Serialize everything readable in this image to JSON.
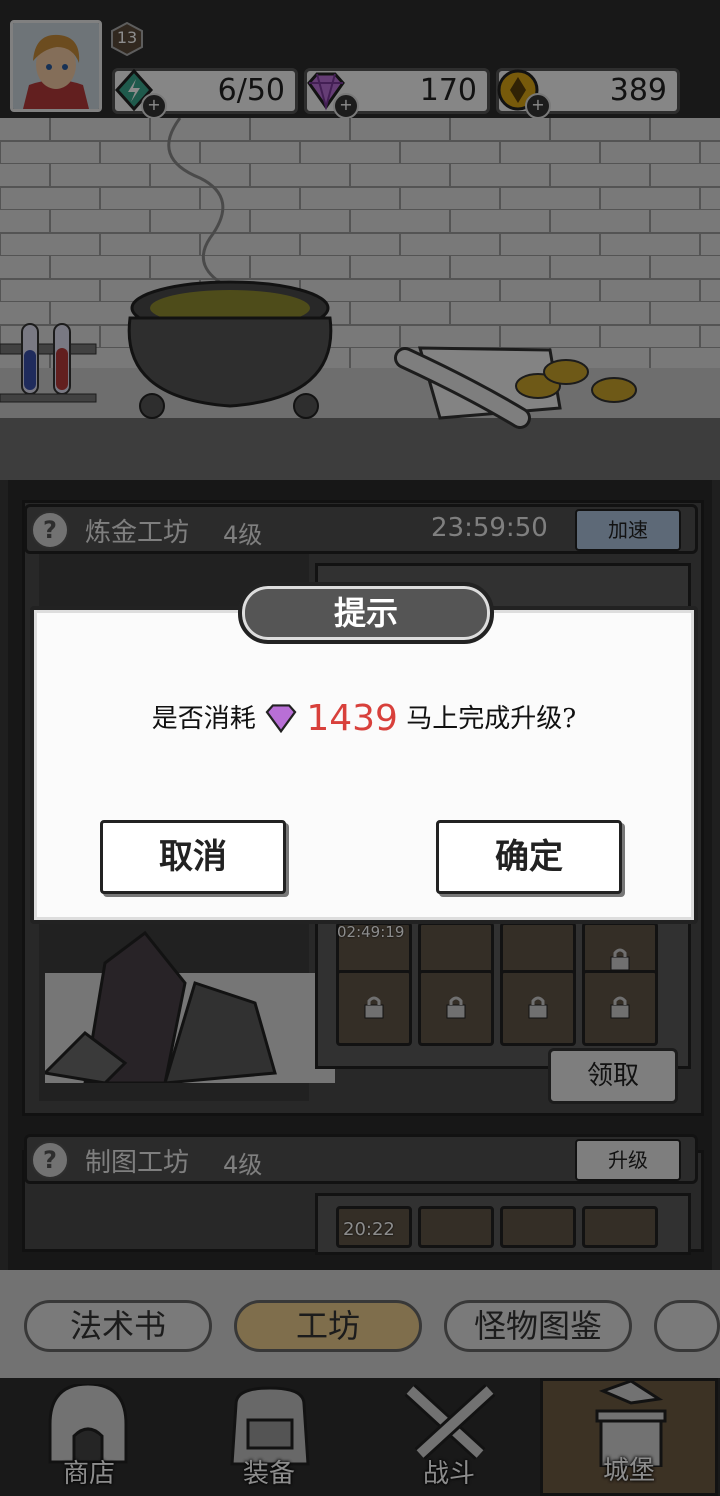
{
  "player": {
    "level": "13"
  },
  "resources": [
    {
      "name": "energy",
      "icon": "energy-gem-icon",
      "value": "6/50",
      "color": "#3aa58a"
    },
    {
      "name": "diamond",
      "icon": "diamond-icon",
      "value": "170",
      "color": "#b86fd6"
    },
    {
      "name": "gold",
      "icon": "gold-coin-icon",
      "value": "389",
      "color": "#d9a514"
    }
  ],
  "workshops": [
    {
      "name": "炼金工坊",
      "level": "4级",
      "timer": "23:59:50",
      "action": "加速",
      "slot_timer": "02:49:19",
      "collect": "领取"
    },
    {
      "name": "制图工坊",
      "level": "4级",
      "action": "升级",
      "slot_timer": "20:22"
    }
  ],
  "tabs": [
    "法术书",
    "工坊",
    "怪物图鉴"
  ],
  "active_tab": "工坊",
  "nav": [
    "商店",
    "装备",
    "战斗",
    "城堡"
  ],
  "active_nav": "城堡",
  "dialog": {
    "title": "提示",
    "message_before": "是否消耗",
    "cost": "1439",
    "message_after": "马上完成升级?",
    "cancel": "取消",
    "confirm": "确定"
  },
  "colors": {
    "cost": "#d8403b",
    "active_tab": "#e8c98a",
    "speedup": "#a9bfd9"
  }
}
